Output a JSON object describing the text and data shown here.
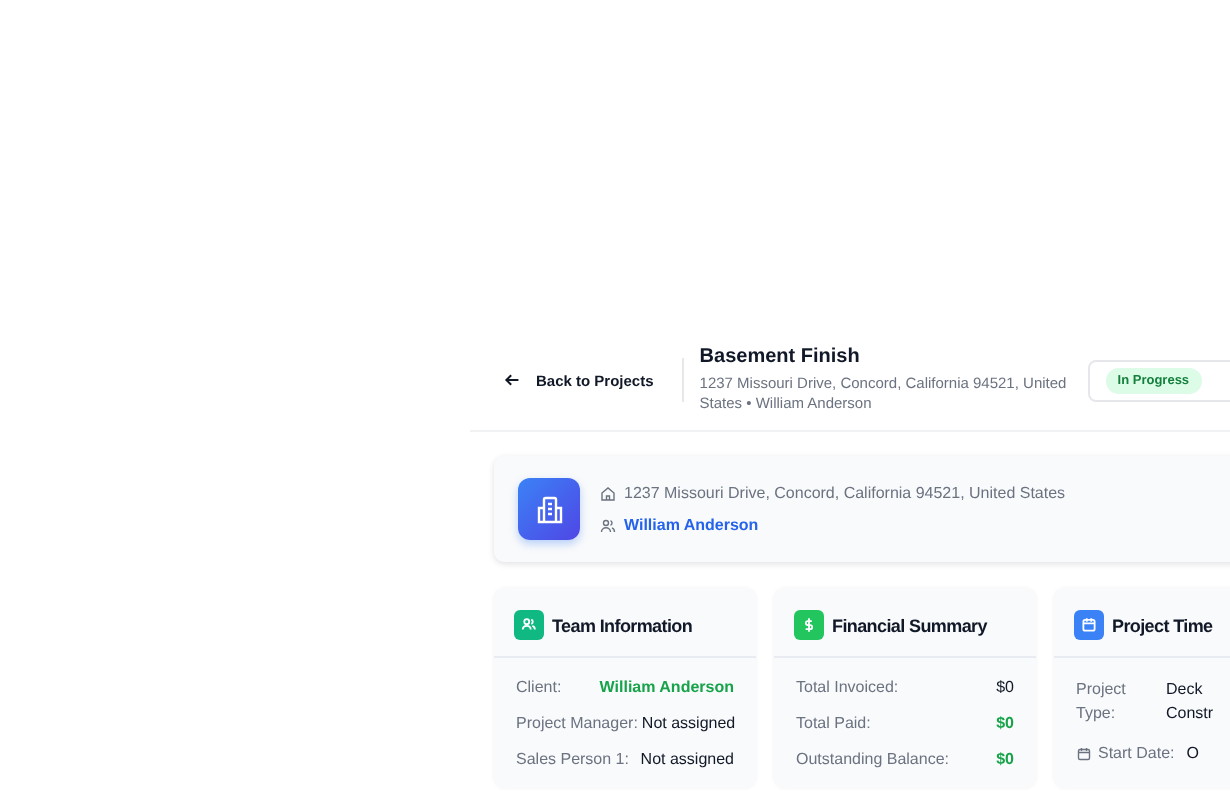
{
  "header": {
    "back_label": "Back to Projects",
    "title": "Basement Finish",
    "subtitle": "1237 Missouri Drive, Concord, California 94521, United States • William Anderson",
    "status": "In Progress"
  },
  "project_info": {
    "address": "1237 Missouri Drive, Concord, California 94521, United States",
    "client": "William Anderson"
  },
  "cards": [
    {
      "kind": "team",
      "title": "Team Information",
      "rows": [
        {
          "kind": "accent",
          "label": "Client:",
          "value": "William Anderson"
        },
        {
          "kind": "plain",
          "label": "Project Manager:",
          "value": "Not assigned"
        },
        {
          "kind": "plain",
          "label": "Sales Person 1:",
          "value": "Not assigned"
        }
      ]
    },
    {
      "kind": "finance",
      "title": "Financial Summary",
      "rows": [
        {
          "kind": "plain",
          "label": "Total Invoiced:",
          "value": "$0"
        },
        {
          "kind": "accent",
          "label": "Total Paid:",
          "value": "$0"
        },
        {
          "kind": "accent",
          "label": "Outstanding Balance:",
          "value": "$0"
        }
      ]
    },
    {
      "kind": "timeline",
      "title": "Project Time",
      "rows": [
        {
          "kind": "plain",
          "label": "Project Type:",
          "value": "Deck Constr"
        },
        {
          "kind": "date",
          "label": "Start Date:",
          "value": "O"
        }
      ]
    }
  ]
}
